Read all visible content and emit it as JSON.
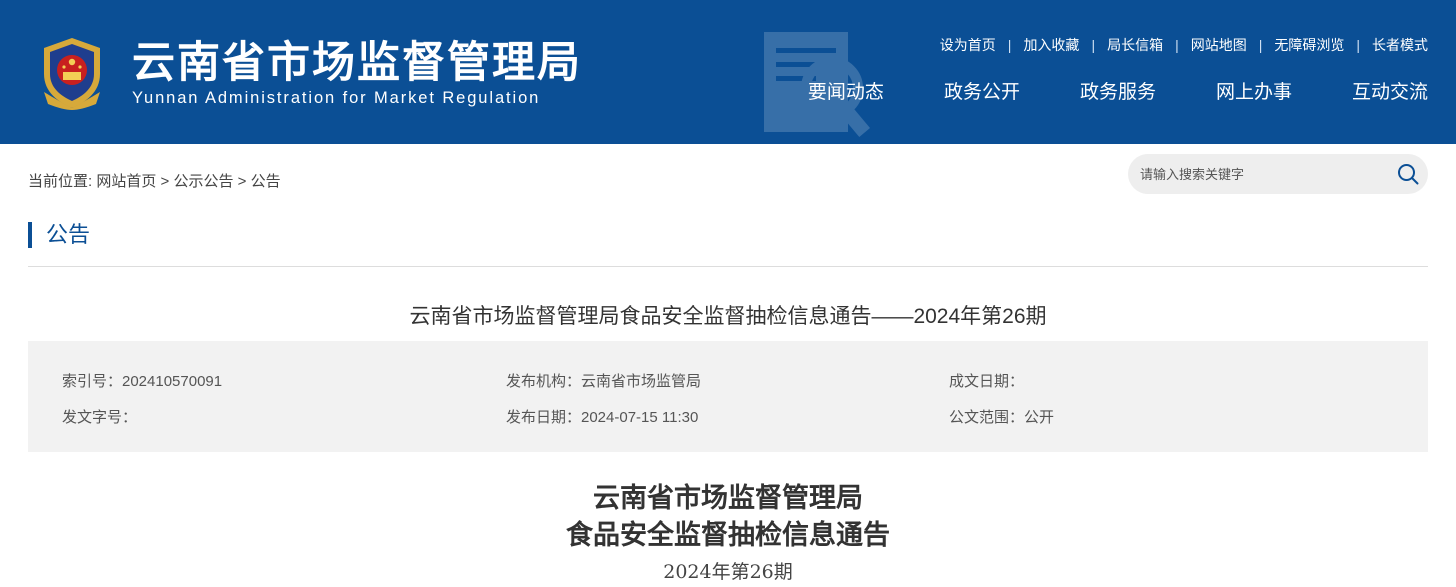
{
  "header": {
    "title": "云南省市场监督管理局",
    "subtitle": "Yunnan Administration for Market Regulation",
    "toplinks": [
      "设为首页",
      "加入收藏",
      "局长信箱",
      "网站地图",
      "无障碍浏览",
      "长者模式"
    ],
    "nav": [
      "要闻动态",
      "政务公开",
      "政务服务",
      "网上办事",
      "互动交流"
    ],
    "bg_color": "#0b4f95"
  },
  "breadcrumb": {
    "prefix": "当前位置:",
    "items": [
      "网站首页",
      "公示公告",
      "公告"
    ],
    "separator": ">"
  },
  "search": {
    "placeholder": "请输入搜索关键字",
    "icon": "search-icon"
  },
  "section": {
    "title": "公告"
  },
  "article": {
    "title": "云南省市场监督管理局食品安全监督抽检信息通告——2024年第26期",
    "meta": {
      "index_no": "索引号：202410570091",
      "publisher": "发布机构：云南省市场监管局",
      "written_date": "成文日期：",
      "doc_no": "发文字号：",
      "publish_date": "发布日期：2024-07-15 11:30",
      "scope": "公文范围：公开"
    },
    "doc_title_line1": "云南省市场监督管理局",
    "doc_title_line2": "食品安全监督抽检信息通告",
    "doc_issue": "2024年第26期"
  }
}
